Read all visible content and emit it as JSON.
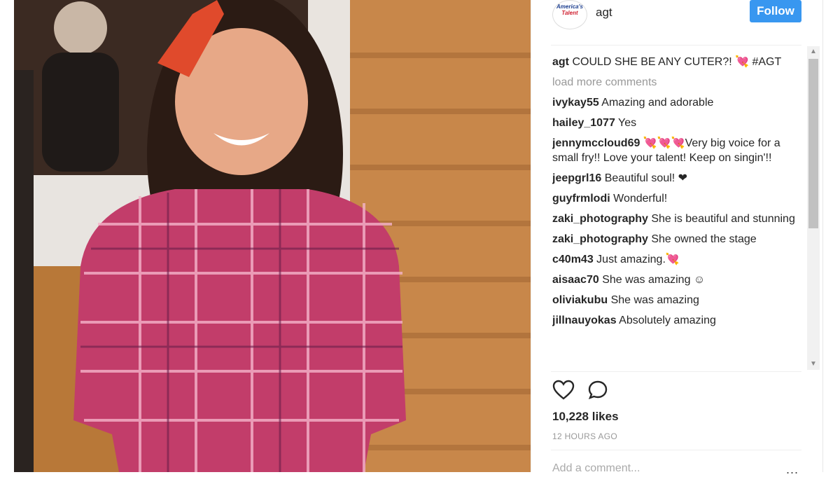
{
  "post": {
    "username": "agt",
    "follow_label": "Follow",
    "avatar_logo_top": "America's",
    "avatar_logo_bottom": "Talent",
    "caption_user": "agt",
    "caption_text": "COULD SHE BE ANY CUTER?! 💘 #AGT",
    "load_more": "load more comments",
    "comments": [
      {
        "user": "ivykay55",
        "text": "Amazing and adorable"
      },
      {
        "user": "hailey_1077",
        "text": "Yes"
      },
      {
        "user": "jennymccloud69",
        "text": "💘💘💘Very big voice for a small fry!! Love your talent! Keep on singin'!!"
      },
      {
        "user": "jeepgrl16",
        "text": "Beautiful soul! ❤"
      },
      {
        "user": "guyfrmlodi",
        "text": "Wonderful!"
      },
      {
        "user": "zaki_photography",
        "text": "She is beautiful and stunning"
      },
      {
        "user": "zaki_photography",
        "text": "She owned the stage"
      },
      {
        "user": "c40m43",
        "text": "Just amazing.💘"
      },
      {
        "user": "aisaac70",
        "text": "She was amazing ☺"
      },
      {
        "user": "oliviakubu",
        "text": "She was amazing"
      },
      {
        "user": "jillnauyokas",
        "text": "Absolutely amazing"
      }
    ],
    "likes": "10,228 likes",
    "time_ago": "12 HOURS AGO",
    "add_comment_placeholder": "Add a comment...",
    "more_options": "..."
  },
  "icons": {
    "like": "heart-icon",
    "comment": "comment-icon",
    "scroll_up": "arrow-up-icon",
    "scroll_down": "arrow-down-icon"
  },
  "colors": {
    "follow_button": "#3897f0",
    "muted_text": "#999999"
  }
}
